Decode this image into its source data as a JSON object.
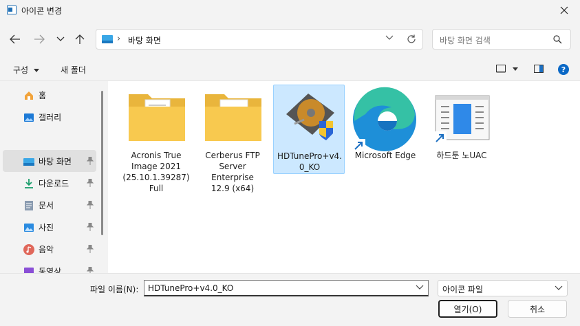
{
  "window": {
    "title": "아이콘 변경"
  },
  "address": {
    "path": "바탕 화면"
  },
  "search": {
    "placeholder": "바탕 화면 검색"
  },
  "toolbar": {
    "organize": "구성",
    "new_folder": "새 폴더"
  },
  "sidebar": {
    "items": [
      {
        "label": "홈",
        "icon": "home-icon",
        "pinned": false,
        "selected": false
      },
      {
        "label": "갤러리",
        "icon": "gallery-icon",
        "pinned": false,
        "selected": false
      },
      {
        "label": "바탕 화면",
        "icon": "desktop-icon",
        "pinned": true,
        "selected": true
      },
      {
        "label": "다운로드",
        "icon": "download-icon",
        "pinned": true,
        "selected": false
      },
      {
        "label": "문서",
        "icon": "document-icon",
        "pinned": true,
        "selected": false
      },
      {
        "label": "사진",
        "icon": "picture-icon",
        "pinned": true,
        "selected": false
      },
      {
        "label": "음악",
        "icon": "music-icon",
        "pinned": true,
        "selected": false
      },
      {
        "label": "동영상",
        "icon": "video-icon",
        "pinned": true,
        "selected": false
      }
    ]
  },
  "files": [
    {
      "lines": [
        "Acronis True",
        "Image 2021",
        "(25.10.1.39287)",
        "Full"
      ],
      "icon": "folder-icon",
      "selected": false
    },
    {
      "lines": [
        "Cerberus FTP",
        "Server Enterprise",
        "12.9 (x64)"
      ],
      "icon": "folder-icon",
      "selected": false
    },
    {
      "lines": [
        "HDTunePro+v4.",
        "0_KO"
      ],
      "icon": "hdd-shield-icon",
      "selected": true
    },
    {
      "lines": [
        "Microsoft Edge"
      ],
      "icon": "edge-icon",
      "selected": false,
      "shortcut": true
    },
    {
      "lines": [
        "하드툰 노UAC"
      ],
      "icon": "app-window-icon",
      "selected": false,
      "shortcut": true
    }
  ],
  "footer": {
    "filename_label": "파일 이름(N):",
    "filename_value": "HDTunePro+v4.0_KO",
    "filetype_value": "아이콘 파일",
    "open_label": "열기(O)",
    "cancel_label": "취소"
  },
  "colors": {
    "accent": "#0067c0",
    "selection": "#cce8ff",
    "folder": "#f8c94f"
  }
}
